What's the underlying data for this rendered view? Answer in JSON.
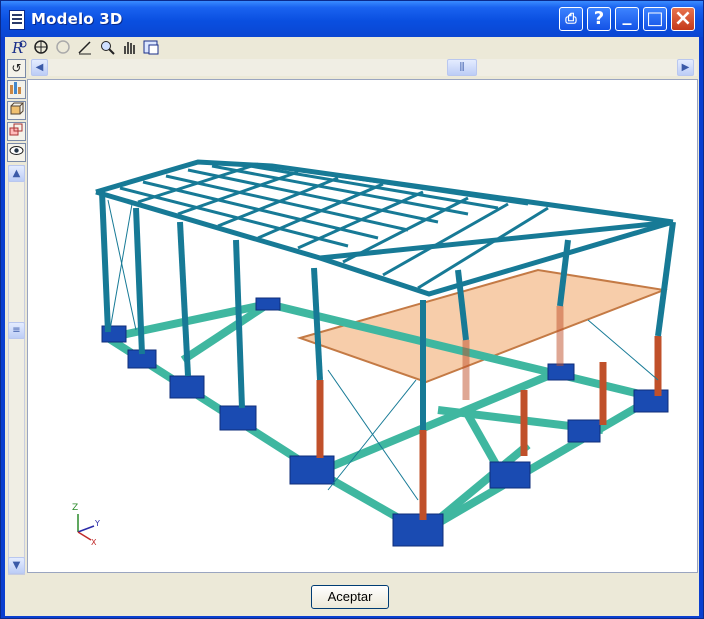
{
  "window": {
    "title": "Modelo 3D"
  },
  "title_buttons": {
    "help": "?",
    "minimize": "_",
    "maximize": "□",
    "close": "×"
  },
  "toolbar": {
    "icons": [
      "zoom-pointer-icon",
      "zoom-extents-icon",
      "zoom-previous-icon",
      "draw-icon",
      "zoom-window-icon",
      "pan-hand-icon",
      "views-icon"
    ]
  },
  "side_toolbar": {
    "icons": [
      "rotate-icon",
      "bars-icon",
      "box-icon",
      "layers-icon",
      "eye-icon"
    ]
  },
  "scrollbars": {
    "up": "▲",
    "down": "▼",
    "left": "◀",
    "right": "▶"
  },
  "axes": {
    "z": "Z",
    "y": "Y",
    "x": "X"
  },
  "colors": {
    "columns": "#177a96",
    "ground_beams": "#3fb7a0",
    "footings": "#1a4bb2",
    "steel_columns": "#c0502a",
    "slab": "#f2b27c"
  },
  "footer": {
    "accept_label": "Aceptar"
  }
}
